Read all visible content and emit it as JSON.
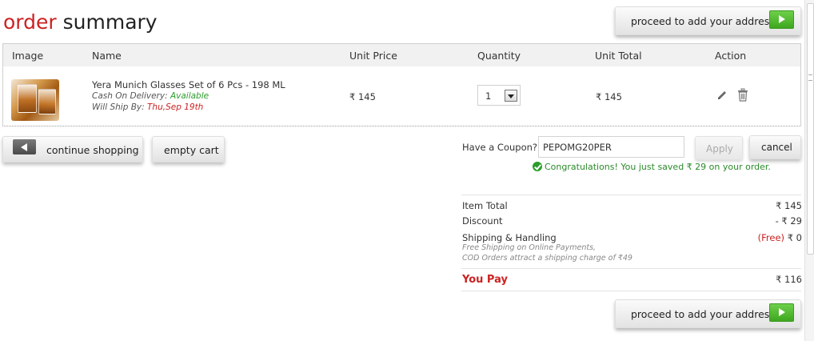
{
  "page": {
    "title_part1": "order",
    "title_part2": "summary",
    "proceed_label": "proceed to add your address"
  },
  "table": {
    "headers": [
      "Image",
      "Name",
      "Unit Price",
      "Quantity",
      "Unit Total",
      "Action"
    ],
    "row": {
      "name": "Yera Munich Glasses Set of 6 Pcs - 198 ML",
      "cod_label": "Cash On Delivery:",
      "cod_value": "Available",
      "ship_label": "Will Ship By:",
      "ship_date": "Thu,Sep 19th",
      "unit_price": "₹ 145",
      "quantity": "1",
      "unit_total": "₹ 145"
    }
  },
  "actions": {
    "continue_label": "continue shopping",
    "empty_label": "empty cart"
  },
  "coupon": {
    "label": "Have a Coupon?",
    "value": "PEPOMG20PER",
    "apply_label": "Apply",
    "cancel_label": "cancel",
    "success_message": "Congratulations! You just saved ₹  29 on your order."
  },
  "summary": {
    "item_total_label": "Item Total",
    "item_total_value": "₹ 145",
    "discount_label": "Discount",
    "discount_value": "- ₹ 29",
    "shipping_label": "Shipping & Handling",
    "shipping_free": "(Free)",
    "shipping_value": "₹ 0",
    "note_1": "Free Shipping on Online Payments,",
    "note_2": "COD Orders attract a shipping charge of ₹49",
    "you_pay_label": "You Pay",
    "you_pay_value": "₹ 116"
  },
  "colors": {
    "accent_red": "#cc2222",
    "success_green": "#2a9d2a",
    "proceed_green": "#4cb82a"
  },
  "icons": [
    "edit-icon",
    "trash-icon",
    "play-arrow-icon",
    "back-arrow-icon",
    "check-circle-icon"
  ]
}
